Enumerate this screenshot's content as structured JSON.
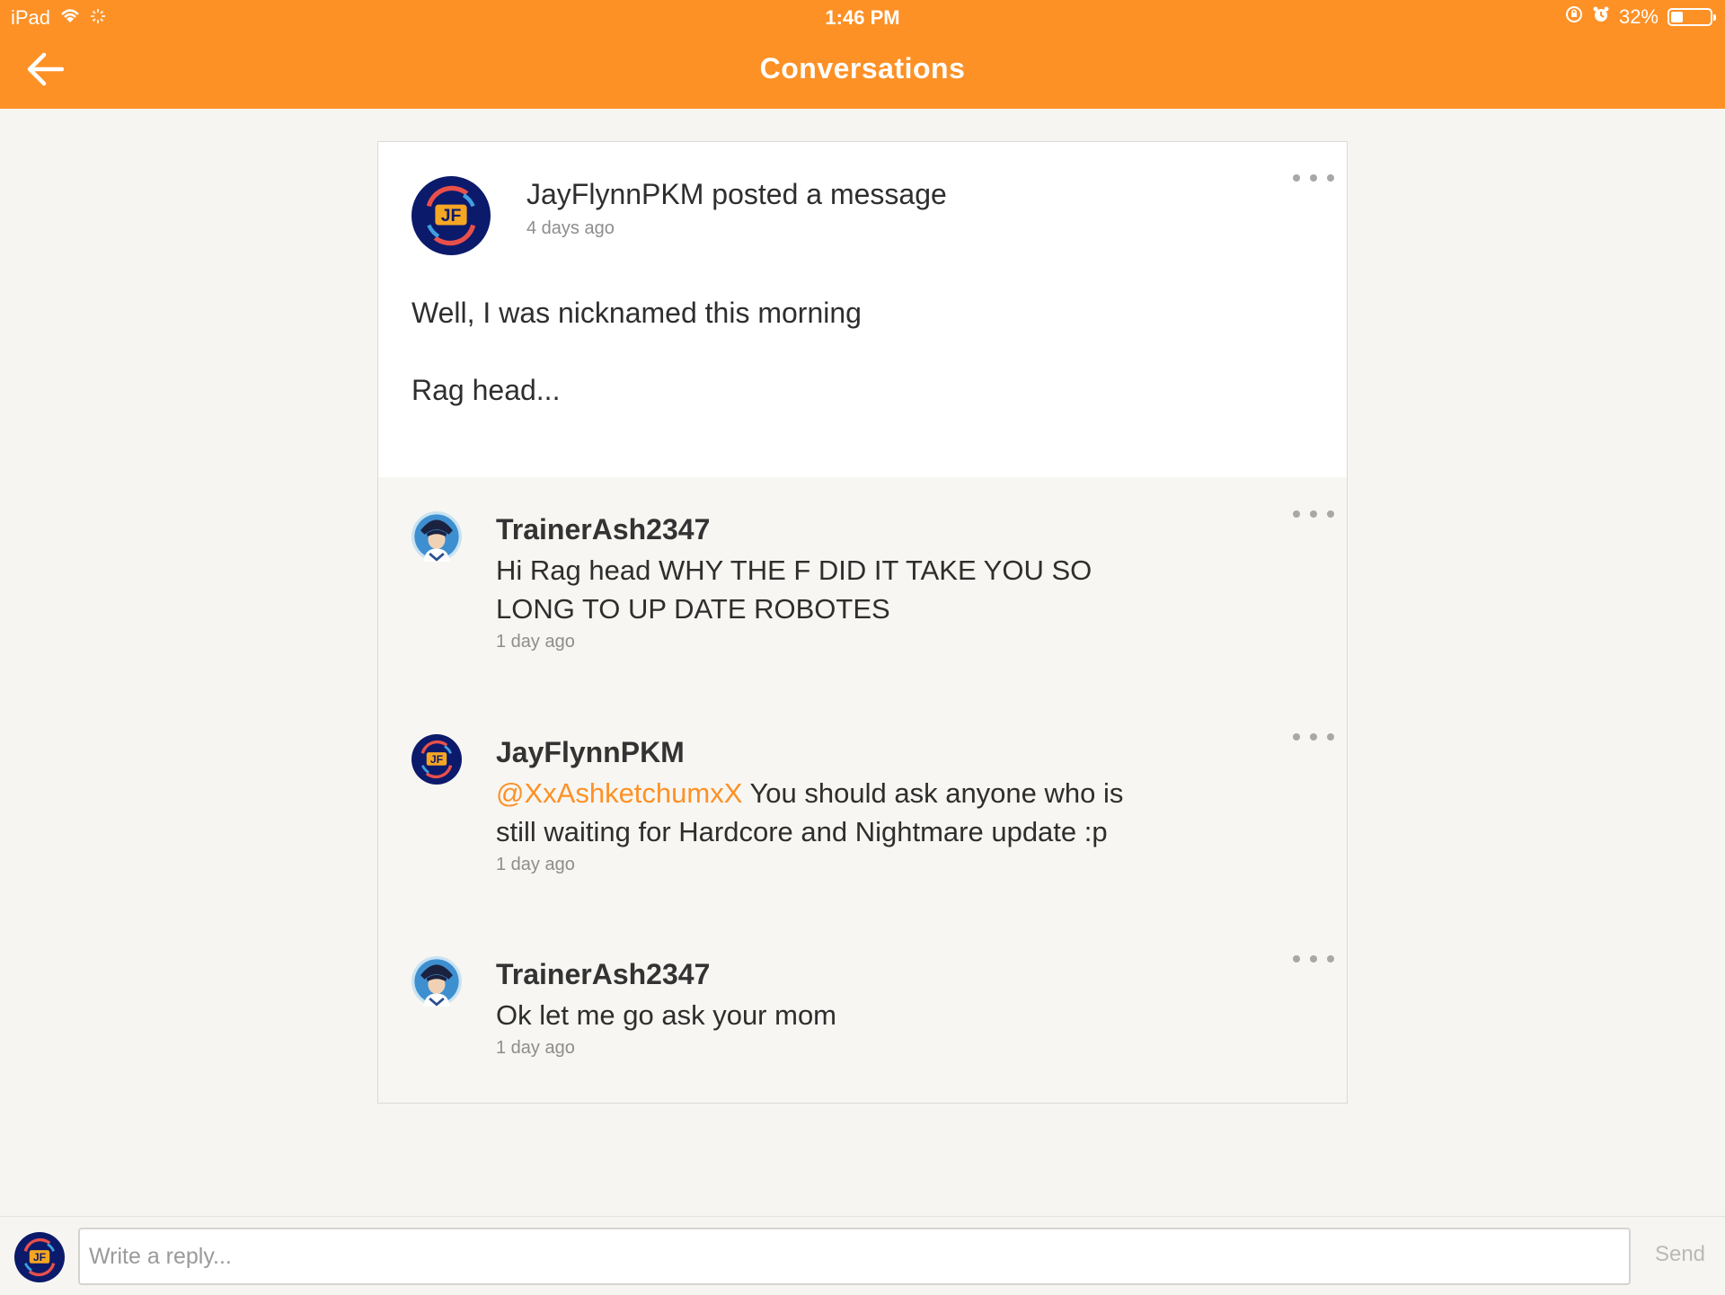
{
  "status_bar": {
    "device": "iPad",
    "time": "1:46 PM",
    "battery_percent": "32%",
    "battery_level": 0.32,
    "icons": [
      "wifi-icon",
      "loading-spinner-icon",
      "orientation-lock-icon",
      "alarm-icon",
      "battery-icon"
    ]
  },
  "nav": {
    "title": "Conversations",
    "back_icon": "arrow-left-icon"
  },
  "colors": {
    "accent": "#fd9126",
    "background": "#f6f5f1",
    "card": "#ffffff",
    "muted_text": "#8d8d8d",
    "text": "#2e2e2e"
  },
  "conversation": {
    "post": {
      "author": "JayFlynnPKM",
      "action": "posted a message",
      "time": "4 days ago",
      "body": [
        "Well, I was nicknamed this morning",
        "Rag head..."
      ],
      "avatar": "jf-logo-avatar"
    },
    "replies": [
      {
        "author": "TrainerAsh2347",
        "mention": "",
        "text": "Hi Rag head WHY THE F DID IT TAKE YOU SO LONG TO UP DATE ROBOTES",
        "time": "1 day ago",
        "avatar": "trainer-ash-avatar"
      },
      {
        "author": "JayFlynnPKM",
        "mention": "@XxAshketchumxX",
        "text": " You should ask anyone who is still waiting for Hardcore and Nightmare update :p",
        "time": "1 day ago",
        "avatar": "jf-logo-avatar"
      },
      {
        "author": "TrainerAsh2347",
        "mention": "",
        "text": "Ok let me go ask your mom",
        "time": "1 day ago",
        "avatar": "trainer-ash-avatar"
      }
    ]
  },
  "composer": {
    "placeholder": "Write a reply...",
    "value": "",
    "send_label": "Send"
  }
}
